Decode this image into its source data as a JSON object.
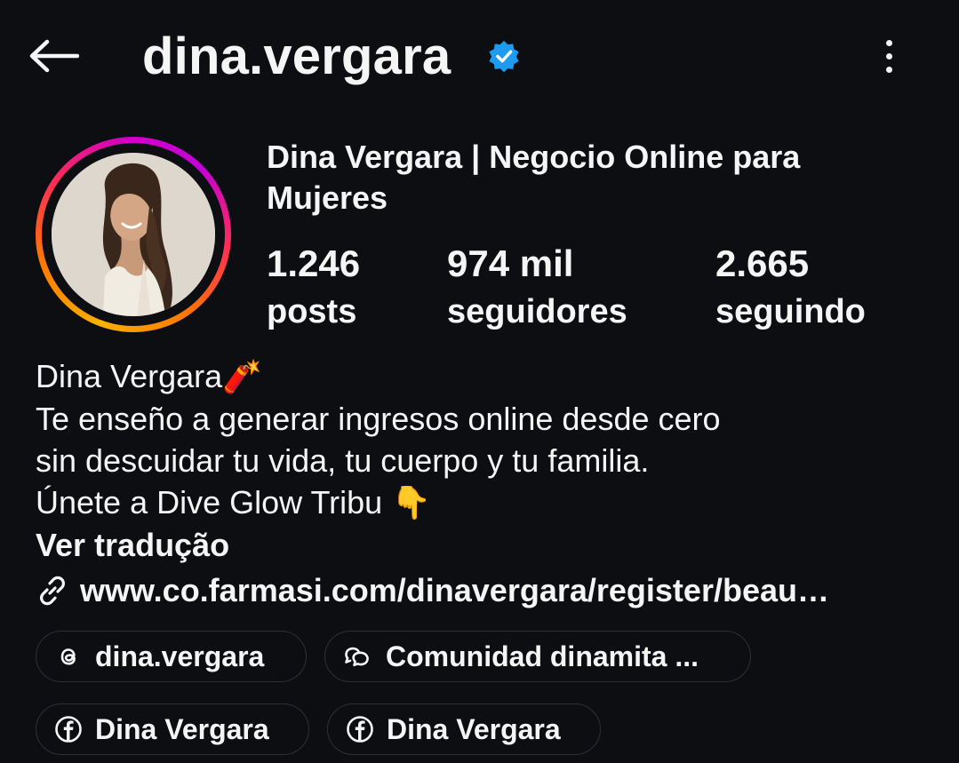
{
  "header": {
    "username": "dina.vergara",
    "back_icon": "arrow-left-icon",
    "verified_icon": "verified-badge-icon",
    "more_icon": "more-vertical-icon"
  },
  "profile": {
    "display_name": "Dina Vergara | Negocio Online para Mujeres",
    "stats": [
      {
        "value": "1.246",
        "label": "posts"
      },
      {
        "value": "974 mil",
        "label": "seguidores"
      },
      {
        "value": "2.665",
        "label": "seguindo"
      }
    ],
    "bio_lines": [
      "Dina Vergara",
      "Te enseño a generar ingresos online desde cero",
      "sin descuidar tu vida, tu cuerpo y tu familia.",
      "Únete a Dive Glow Tribu"
    ],
    "bio_emojis": {
      "firecracker": "🧨",
      "pointing_down": "👇"
    },
    "translate_label": "Ver tradução",
    "link_text": "www.co.farmasi.com/dinavergara/register/beau…",
    "link_icon": "link-icon"
  },
  "pills": [
    {
      "label": "dina.vergara",
      "icon": "threads-icon"
    },
    {
      "label": "Comunidad dinamita ...",
      "icon": "chat-bubbles-icon"
    },
    {
      "label": "Dina Vergara",
      "icon": "facebook-icon"
    },
    {
      "label": "Dina Vergara",
      "icon": "facebook-icon"
    }
  ],
  "colors": {
    "background": "#0c0e12",
    "text": "#f5f5f5",
    "verified_blue": "#1d9bf0",
    "pill_border": "#2e3036"
  }
}
